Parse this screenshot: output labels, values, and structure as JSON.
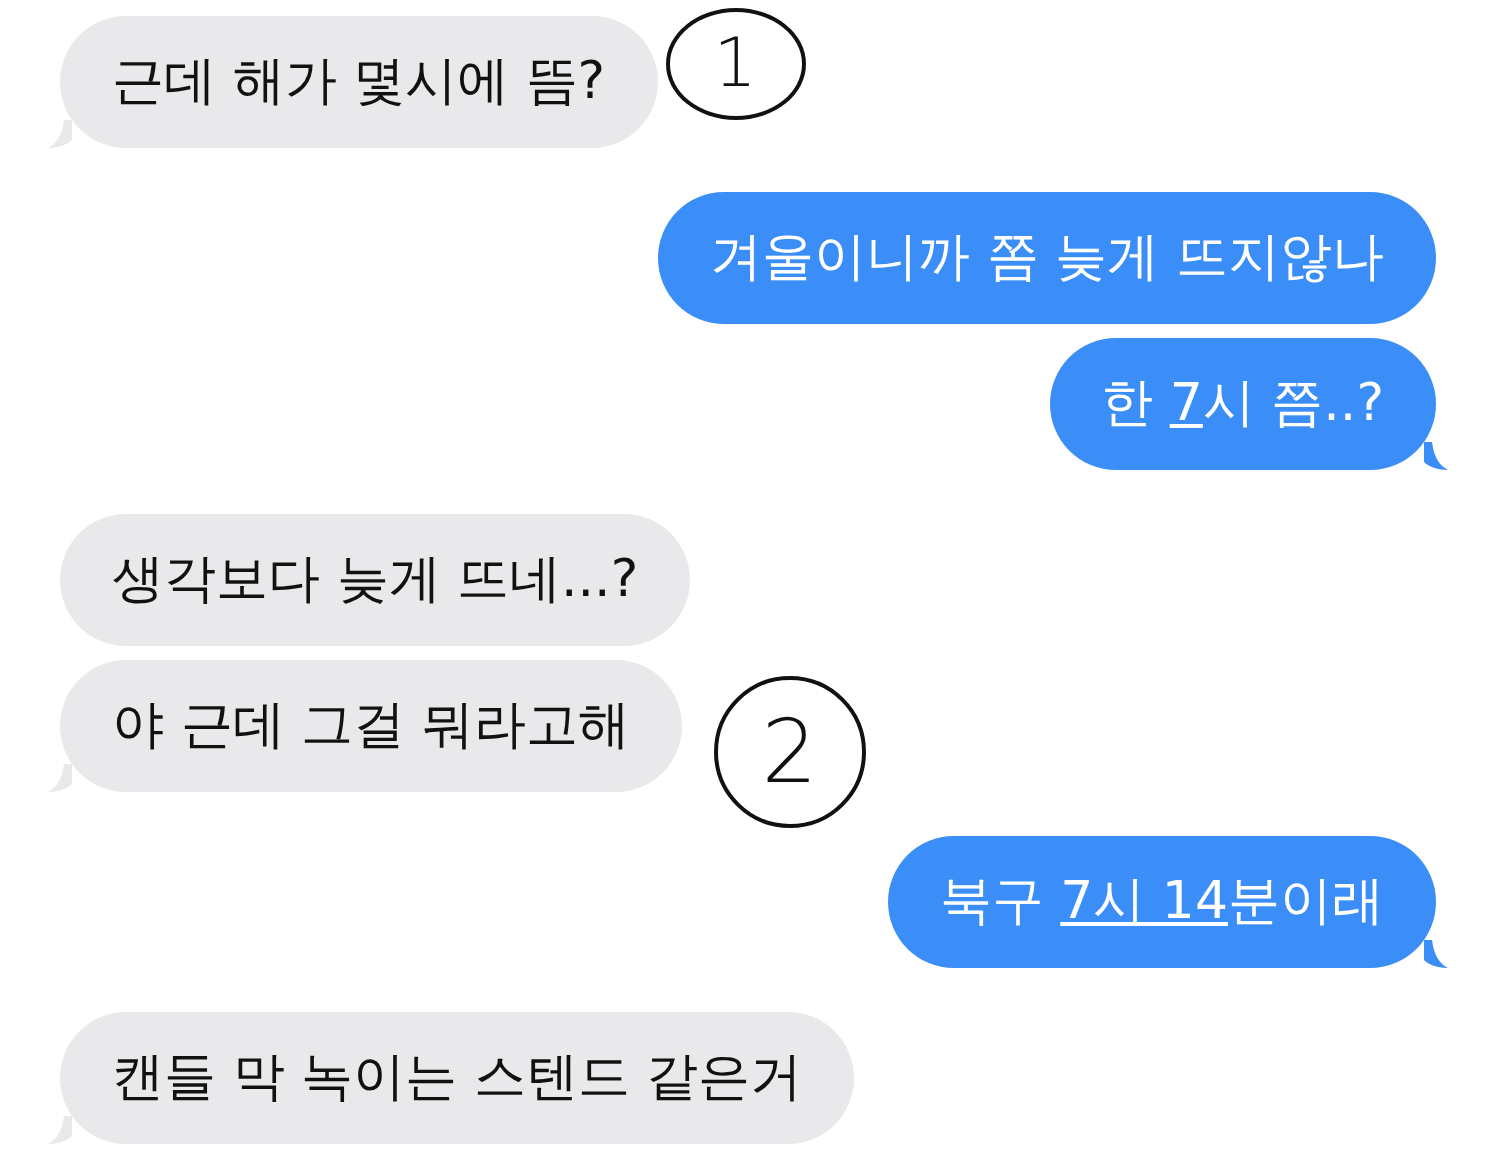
{
  "messages": [
    {
      "kind": "received",
      "tail": true,
      "parts": [
        {
          "kind": "plain",
          "text": "근데 해가 몇시에 뜸?"
        }
      ],
      "annotation": "1"
    },
    {
      "kind": "sent",
      "tail": false,
      "parts": [
        {
          "kind": "plain",
          "text": "겨울이니까 쫌 늦게 뜨지않나"
        }
      ]
    },
    {
      "kind": "sent",
      "tail": true,
      "parts": [
        {
          "kind": "plain",
          "text": "한 "
        },
        {
          "kind": "link",
          "text": "7"
        },
        {
          "kind": "plain",
          "text": "시 쯤..?"
        }
      ]
    },
    {
      "kind": "received",
      "tail": false,
      "parts": [
        {
          "kind": "plain",
          "text": "생각보다 늦게 뜨네...?"
        }
      ]
    },
    {
      "kind": "received",
      "tail": true,
      "parts": [
        {
          "kind": "plain",
          "text": "야 근데 그걸 뭐라고해"
        }
      ],
      "annotation": "2"
    },
    {
      "kind": "sent",
      "tail": true,
      "parts": [
        {
          "kind": "plain",
          "text": "북구 "
        },
        {
          "kind": "link",
          "text": "7시 14"
        },
        {
          "kind": "plain",
          "text": "분이래"
        }
      ]
    },
    {
      "kind": "received",
      "tail": true,
      "parts": [
        {
          "kind": "plain",
          "text": "캔들 막 녹이는 스텐드 같은거"
        }
      ]
    }
  ]
}
